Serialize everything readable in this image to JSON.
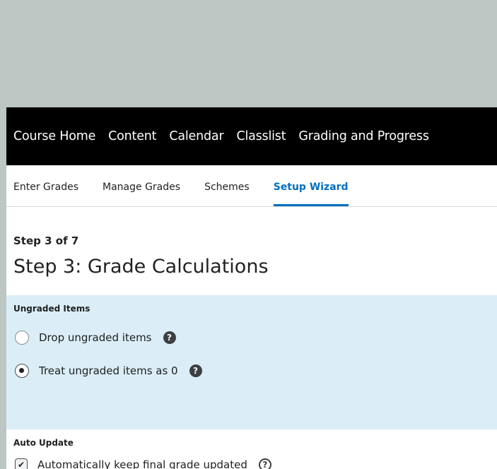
{
  "nav": {
    "items": [
      "Course Home",
      "Content",
      "Calendar",
      "Classlist",
      "Grading and Progress"
    ]
  },
  "subnav": {
    "tabs": [
      "Enter Grades",
      "Manage Grades",
      "Schemes",
      "Setup Wizard"
    ],
    "active": "Setup Wizard"
  },
  "step": {
    "label": "Step 3 of 7",
    "title": "Step 3: Grade Calculations"
  },
  "ungraded": {
    "heading": "Ungraded Items",
    "options": [
      {
        "label": "Drop ungraded items",
        "selected": false
      },
      {
        "label": "Treat ungraded items as 0",
        "selected": true
      }
    ]
  },
  "auto_update": {
    "heading": "Auto Update",
    "checkbox_label": "Automatically keep final grade updated",
    "checked": true
  },
  "icons": {
    "help": "question-circle-icon",
    "radio": "radio-icon",
    "checkbox": "checkbox-icon"
  },
  "colors": {
    "background": "#bcc7c3",
    "nav_bar": "#000000",
    "accent": "#006fbf",
    "panel": "#dbeef7"
  }
}
